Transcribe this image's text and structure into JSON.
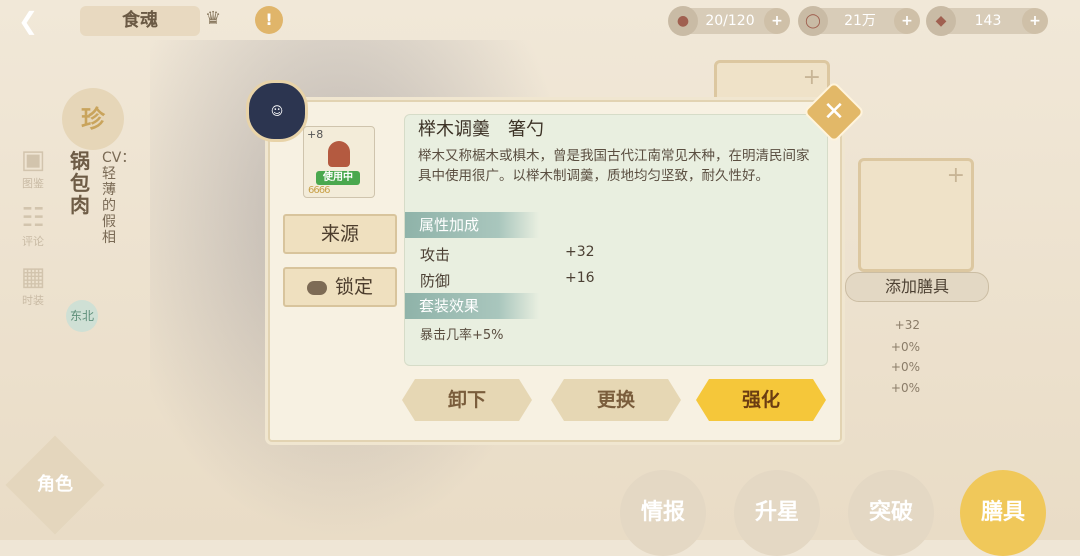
{
  "topbar": {
    "title": "食魂",
    "stamina": "20/120",
    "coins": "21万",
    "gems": "143"
  },
  "sidebar": {
    "items": [
      {
        "label": "图鉴"
      },
      {
        "label": "评论"
      },
      {
        "label": "时装"
      }
    ],
    "rarity_badge": "珍",
    "name": "锅包肉",
    "cv": "CV：轻薄的假相",
    "region": "东北",
    "bottom_emblem": "角色"
  },
  "right_panel": {
    "add_utensil_label": "添加膳具",
    "stats": [
      "+32",
      "+0%",
      "+0%",
      "+0%"
    ]
  },
  "bottom_nav": [
    "情报",
    "升星",
    "突破",
    "膳具"
  ],
  "dialog": {
    "item_level": "+8",
    "in_use": "使用中",
    "item_stars": "6666",
    "source_button": "来源",
    "lock_button": "锁定",
    "item_name": "榉木调羹　箸勺",
    "description": "榉木又称椐木或椇木，曾是我国古代江南常见木种，在明清民间家具中使用很广。以榉木制调羹，质地均匀坚致，耐久性好。",
    "attr_header": "属性加成",
    "stats": [
      {
        "name": "攻击",
        "value": "+32"
      },
      {
        "name": "防御",
        "value": "+16"
      }
    ],
    "set_header": "套装效果",
    "set_effect": "暴击几率+5%",
    "unequip_button": "卸下",
    "replace_button": "更换",
    "upgrade_button": "强化"
  },
  "colors": {
    "panel_bg": "#f7f1e2",
    "section_header": "#8fb3a9",
    "primary_button": "#f5c73a"
  }
}
